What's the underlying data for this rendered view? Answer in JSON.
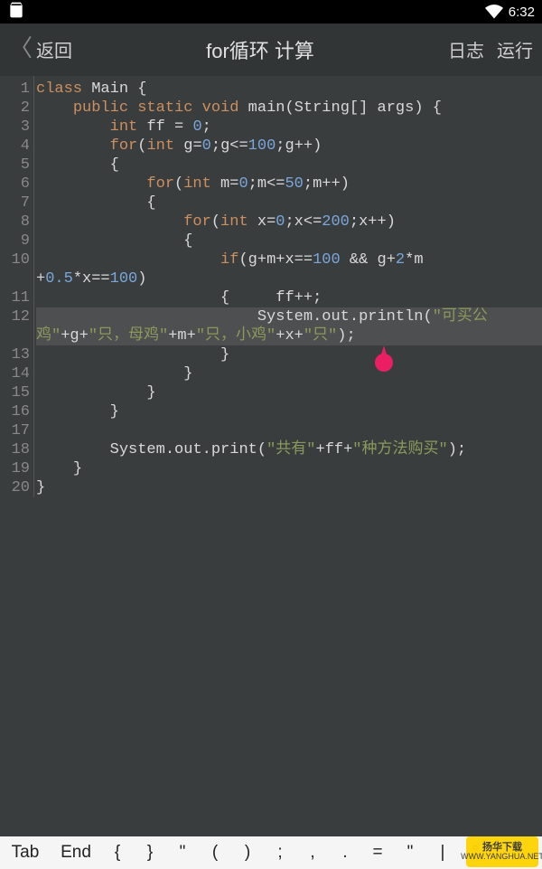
{
  "status": {
    "time": "6:32"
  },
  "appbar": {
    "back": "返回",
    "title": "for循环 计算",
    "log": "日志",
    "run": "运行"
  },
  "code": {
    "l1": [
      [
        "kw",
        "class"
      ],
      [
        "sp",
        " "
      ],
      [
        "id",
        "Main"
      ],
      [
        "sp",
        " "
      ],
      [
        "op",
        "{"
      ]
    ],
    "l2": [
      [
        "sp",
        "    "
      ],
      [
        "kw",
        "public"
      ],
      [
        "sp",
        " "
      ],
      [
        "kw",
        "static"
      ],
      [
        "sp",
        " "
      ],
      [
        "kw",
        "void"
      ],
      [
        "sp",
        " "
      ],
      [
        "id",
        "main"
      ],
      [
        "op",
        "("
      ],
      [
        "id",
        "String"
      ],
      [
        "op",
        "[]"
      ],
      [
        "sp",
        " "
      ],
      [
        "id",
        "args"
      ],
      [
        "op",
        ")"
      ],
      [
        "sp",
        " "
      ],
      [
        "op",
        "{"
      ]
    ],
    "l3": [
      [
        "sp",
        "        "
      ],
      [
        "kw",
        "int"
      ],
      [
        "sp",
        " "
      ],
      [
        "id",
        "ff"
      ],
      [
        "sp",
        " "
      ],
      [
        "op",
        "="
      ],
      [
        "sp",
        " "
      ],
      [
        "num",
        "0"
      ],
      [
        "op",
        ";"
      ]
    ],
    "l4": [
      [
        "sp",
        "        "
      ],
      [
        "kw",
        "for"
      ],
      [
        "op",
        "("
      ],
      [
        "kw",
        "int"
      ],
      [
        "sp",
        " "
      ],
      [
        "id",
        "g"
      ],
      [
        "op",
        "="
      ],
      [
        "num",
        "0"
      ],
      [
        "op",
        ";"
      ],
      [
        "id",
        "g"
      ],
      [
        "op",
        "<="
      ],
      [
        "num",
        "100"
      ],
      [
        "op",
        ";"
      ],
      [
        "id",
        "g"
      ],
      [
        "op",
        "++"
      ],
      [
        "op",
        ")"
      ]
    ],
    "l5": [
      [
        "sp",
        "        "
      ],
      [
        "op",
        "{"
      ]
    ],
    "l6": [
      [
        "sp",
        "            "
      ],
      [
        "kw",
        "for"
      ],
      [
        "op",
        "("
      ],
      [
        "kw",
        "int"
      ],
      [
        "sp",
        " "
      ],
      [
        "id",
        "m"
      ],
      [
        "op",
        "="
      ],
      [
        "num",
        "0"
      ],
      [
        "op",
        ";"
      ],
      [
        "id",
        "m"
      ],
      [
        "op",
        "<="
      ],
      [
        "num",
        "50"
      ],
      [
        "op",
        ";"
      ],
      [
        "id",
        "m"
      ],
      [
        "op",
        "++"
      ],
      [
        "op",
        ")"
      ]
    ],
    "l7": [
      [
        "sp",
        "            "
      ],
      [
        "op",
        "{"
      ]
    ],
    "l8": [
      [
        "sp",
        "                "
      ],
      [
        "kw",
        "for"
      ],
      [
        "op",
        "("
      ],
      [
        "kw",
        "int"
      ],
      [
        "sp",
        " "
      ],
      [
        "id",
        "x"
      ],
      [
        "op",
        "="
      ],
      [
        "num",
        "0"
      ],
      [
        "op",
        ";"
      ],
      [
        "id",
        "x"
      ],
      [
        "op",
        "<="
      ],
      [
        "num",
        "200"
      ],
      [
        "op",
        ";"
      ],
      [
        "id",
        "x"
      ],
      [
        "op",
        "++"
      ],
      [
        "op",
        ")"
      ]
    ],
    "l9": [
      [
        "sp",
        "                "
      ],
      [
        "op",
        "{"
      ]
    ],
    "l10a": [
      [
        "sp",
        "                    "
      ],
      [
        "kw",
        "if"
      ],
      [
        "op",
        "("
      ],
      [
        "id",
        "g"
      ],
      [
        "op",
        "+"
      ],
      [
        "id",
        "m"
      ],
      [
        "op",
        "+"
      ],
      [
        "id",
        "x"
      ],
      [
        "op",
        "=="
      ],
      [
        "num",
        "100"
      ],
      [
        "sp",
        " "
      ],
      [
        "op",
        "&&"
      ],
      [
        "sp",
        " "
      ],
      [
        "id",
        "g"
      ],
      [
        "op",
        "+"
      ],
      [
        "num",
        "2"
      ],
      [
        "op",
        "*"
      ],
      [
        "id",
        "m"
      ]
    ],
    "l10b": [
      [
        "op",
        "+"
      ],
      [
        "num",
        "0.5"
      ],
      [
        "op",
        "*"
      ],
      [
        "id",
        "x"
      ],
      [
        "op",
        "=="
      ],
      [
        "num",
        "100"
      ],
      [
        "op",
        ")"
      ]
    ],
    "l11": [
      [
        "sp",
        "                    "
      ],
      [
        "op",
        "{"
      ],
      [
        "sp",
        "     "
      ],
      [
        "id",
        "ff"
      ],
      [
        "op",
        "++;"
      ]
    ],
    "l12a": [
      [
        "sp",
        "                        "
      ],
      [
        "id",
        "System"
      ],
      [
        "op",
        "."
      ],
      [
        "id",
        "out"
      ],
      [
        "op",
        "."
      ],
      [
        "id",
        "println"
      ],
      [
        "op",
        "("
      ],
      [
        "str",
        "\"可买公"
      ]
    ],
    "l12b": [
      [
        "str",
        "鸡\""
      ],
      [
        "op",
        "+"
      ],
      [
        "id",
        "g"
      ],
      [
        "op",
        "+"
      ],
      [
        "str",
        "\"只，母鸡\""
      ],
      [
        "op",
        "+"
      ],
      [
        "id",
        "m"
      ],
      [
        "op",
        "+"
      ],
      [
        "str",
        "\"只，小鸡\""
      ],
      [
        "op",
        "+"
      ],
      [
        "id",
        "x"
      ],
      [
        "op",
        "+"
      ],
      [
        "str",
        "\"只\""
      ],
      [
        "op",
        ");"
      ]
    ],
    "l13": [
      [
        "sp",
        "                    "
      ],
      [
        "op",
        "}"
      ]
    ],
    "l14": [
      [
        "sp",
        "                "
      ],
      [
        "op",
        "}"
      ]
    ],
    "l15": [
      [
        "sp",
        "            "
      ],
      [
        "op",
        "}"
      ]
    ],
    "l16": [
      [
        "sp",
        "        "
      ],
      [
        "op",
        "}"
      ]
    ],
    "l17": [
      [
        "sp",
        ""
      ]
    ],
    "l18": [
      [
        "sp",
        "        "
      ],
      [
        "id",
        "System"
      ],
      [
        "op",
        "."
      ],
      [
        "id",
        "out"
      ],
      [
        "op",
        "."
      ],
      [
        "id",
        "print"
      ],
      [
        "op",
        "("
      ],
      [
        "str",
        "\"共有\""
      ],
      [
        "op",
        "+"
      ],
      [
        "id",
        "ff"
      ],
      [
        "op",
        "+"
      ],
      [
        "str",
        "\"种方法购买\""
      ],
      [
        "op",
        ");"
      ]
    ],
    "l19": [
      [
        "sp",
        "    "
      ],
      [
        "op",
        "}"
      ]
    ],
    "l20": [
      [
        "op",
        "}"
      ]
    ]
  },
  "gutter": [
    "1",
    "2",
    "3",
    "4",
    "5",
    "6",
    "7",
    "8",
    "9",
    "10",
    "",
    "11",
    "12",
    "",
    "13",
    "14",
    "15",
    "16",
    "17",
    "18",
    "19",
    "20"
  ],
  "keyrow": [
    "Tab",
    "End",
    "{",
    "}",
    "\"",
    "(",
    ")",
    ";",
    ",",
    ".",
    "=",
    "\"",
    "|",
    "°"
  ],
  "watermark": {
    "top": "扬华下载",
    "bottom": "WWW.YANGHUA.NET"
  },
  "cursor": {
    "visual_line_index": 13,
    "char": 38
  }
}
